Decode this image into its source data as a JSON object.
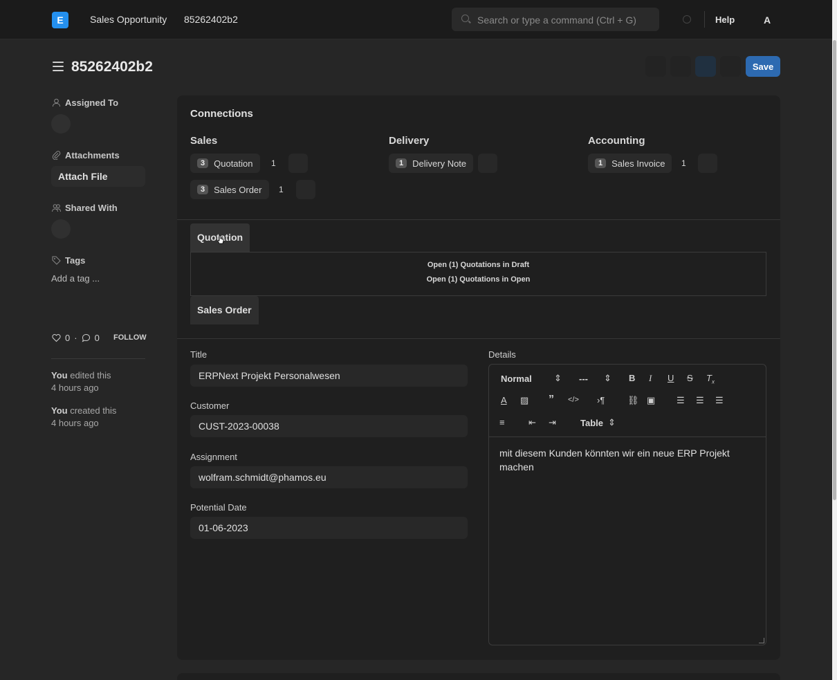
{
  "navbar": {
    "logo": "E",
    "breadcrumbs": [
      "Sales Opportunity",
      "85262402b2"
    ],
    "search_placeholder": "Search or type a command (Ctrl + G)",
    "help_label": "Help",
    "avatar": "A"
  },
  "page": {
    "title": "85262402b2",
    "save_label": "Save"
  },
  "sidebar": {
    "assigned_to_label": "Assigned To",
    "attachments_label": "Attachments",
    "attach_file_label": "Attach File",
    "shared_with_label": "Shared With",
    "tags_label": "Tags",
    "add_tag_label": "Add a tag ...",
    "likes": "0",
    "comments": "0",
    "follow_label": "FOLLOW",
    "timeline": [
      {
        "actor": "You",
        "action": "edited this",
        "time": "4 hours ago"
      },
      {
        "actor": "You",
        "action": "created this",
        "time": "4 hours ago"
      }
    ]
  },
  "connections": {
    "title": "Connections",
    "groups": [
      {
        "title": "Sales",
        "items": [
          {
            "badge": "3",
            "label": "Quotation",
            "count": "1"
          },
          {
            "badge": "3",
            "label": "Sales Order",
            "count": "1"
          }
        ]
      },
      {
        "title": "Delivery",
        "items": [
          {
            "badge": "1",
            "label": "Delivery Note",
            "count": ""
          }
        ]
      },
      {
        "title": "Accounting",
        "items": [
          {
            "badge": "1",
            "label": "Sales Invoice",
            "count": "1"
          }
        ]
      }
    ]
  },
  "tabs": {
    "quotation_label": "Quotation",
    "quotation_lines": [
      "Open (1) Quotations in Draft",
      "Open (1) Quotations in Open"
    ],
    "sales_order_label": "Sales Order"
  },
  "form": {
    "title_label": "Title",
    "title_value": "ERPNext Projekt Personalwesen",
    "customer_label": "Customer",
    "customer_value": "CUST-2023-00038",
    "assignment_label": "Assignment",
    "assignment_value": "wolfram.schmidt@phamos.eu",
    "potential_date_label": "Potential Date",
    "potential_date_value": "01-06-2023",
    "details_label": "Details",
    "editor": {
      "format_select": "Normal",
      "size_select": "---",
      "table_select": "Table",
      "content": "mit diesem Kunden könnten wir ein neue ERP Projekt machen"
    }
  }
}
